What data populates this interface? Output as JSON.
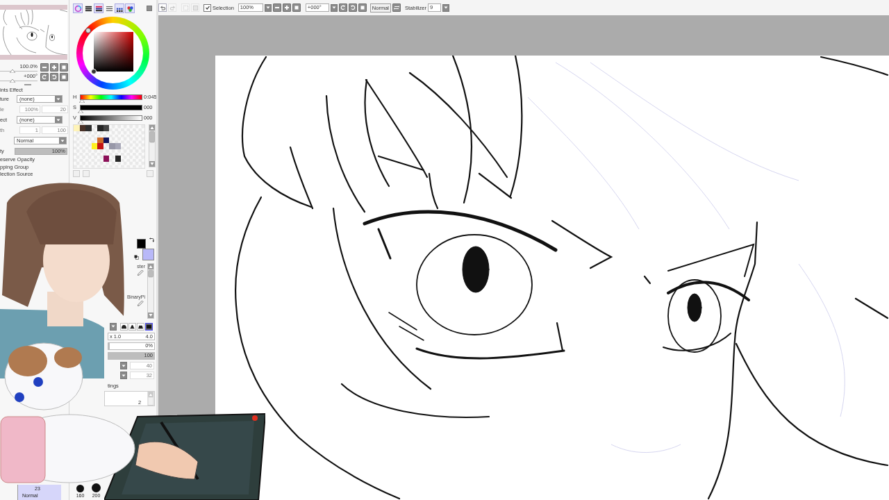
{
  "navigator": {
    "zoom": {
      "value": "100.0%",
      "level": 0.33
    },
    "angle": {
      "value": "+000°",
      "level": 0.33
    }
  },
  "layer_properties": {
    "section": "ints Effect",
    "rows": [
      {
        "kind": "dropdown",
        "label": "ture",
        "value": "(none)",
        "disabled": false
      },
      {
        "kind": "pair",
        "label": "le",
        "value": "100%",
        "second": "20",
        "disabled": true
      },
      {
        "kind": "dropdown",
        "label": "ect",
        "value": "(none)",
        "disabled": false
      },
      {
        "kind": "pair",
        "label": "th",
        "value": "1",
        "second": "100",
        "disabled": true
      },
      {
        "kind": "dropdown",
        "value": "Normal",
        "disabled": false
      },
      {
        "kind": "slider",
        "label": "ty",
        "reading": "100%",
        "level": 1,
        "disabled": false
      }
    ],
    "options": [
      "eserve Opacity",
      "pping Group",
      "lection Source"
    ]
  },
  "layer_entry": {
    "name": "23",
    "mode": "Normal",
    "selected": true
  },
  "color_panel": {
    "modes": [
      {
        "kind": "wheel",
        "on": true
      },
      {
        "kind": "rgb",
        "on": false
      },
      {
        "kind": "hsv",
        "on": true
      },
      {
        "kind": "lines",
        "on": false
      },
      {
        "kind": "swatches",
        "on": true
      },
      {
        "kind": "scratchpad",
        "on": true
      }
    ],
    "sliders": [
      {
        "label": "H",
        "kind": "hue",
        "level": 0.02,
        "reading": "0:045"
      },
      {
        "label": "S",
        "kind": "saturation",
        "level": 0,
        "reading": "000"
      },
      {
        "label": "V",
        "kind": "value",
        "level": 0,
        "reading": "000"
      }
    ],
    "swatch_rows": [
      [
        {
          "color": "#fff4b8"
        },
        {
          "color": "#4a3228"
        },
        {
          "color": "#2e2e2e"
        },
        null,
        {
          "color": "#242424"
        },
        {
          "color": "#454545"
        },
        null,
        null,
        null,
        null,
        null,
        null
      ],
      [
        null,
        null,
        null,
        null,
        null,
        null,
        null,
        null,
        null,
        null,
        null,
        null
      ],
      [
        null,
        null,
        null,
        null,
        {
          "color": "#d06a28"
        },
        {
          "color": "#14145a"
        },
        null,
        null,
        null,
        null,
        null,
        null
      ],
      [
        null,
        null,
        null,
        {
          "color": "#fff020"
        },
        {
          "color": "#c41414"
        },
        null,
        {
          "color": "#9898a8"
        },
        {
          "color": "#a8a8b8"
        },
        null,
        null,
        null,
        null
      ],
      [
        null,
        null,
        null,
        null,
        null,
        null,
        null,
        null,
        null,
        null,
        null,
        null
      ],
      [
        null,
        null,
        null,
        null,
        null,
        {
          "color": "#8c1058"
        },
        null,
        {
          "color": "#262626"
        },
        null,
        null,
        null,
        null
      ],
      [
        null,
        null,
        null,
        null,
        null,
        null,
        null,
        null,
        null,
        null,
        null,
        null
      ]
    ],
    "current_colors": [
      {
        "color": "#000000"
      },
      {
        "color": "#b8b8f8"
      }
    ]
  },
  "tools": [
    "ster",
    "BinaryPi"
  ],
  "brush": {
    "tips": [
      {
        "kind": "dome",
        "selected": false
      },
      {
        "kind": "triangle",
        "selected": false
      },
      {
        "kind": "trapezoid",
        "selected": false
      },
      {
        "kind": "square",
        "selected": true
      }
    ],
    "size": {
      "multiplier": "x 1.0",
      "value": "4.0"
    },
    "min_size": {
      "reading": "0%",
      "level": 0
    },
    "density": {
      "reading": "100",
      "level": 1
    },
    "texture_fields": [
      {
        "value": "40",
        "disabled": true
      },
      {
        "value": "32",
        "disabled": true
      }
    ],
    "section": "tings",
    "list_items": [
      "2"
    ],
    "size_presets": [
      {
        "label": "160"
      },
      {
        "label": "200"
      }
    ]
  },
  "toolbar": {
    "history": [
      {
        "kind": "undo",
        "disabled": false
      },
      {
        "kind": "redo",
        "disabled": true
      },
      {
        "kind": "deselect",
        "disabled": true
      },
      {
        "kind": "invert",
        "disabled": true
      }
    ],
    "selection": {
      "label": "Selection",
      "checked": true
    },
    "zoom": "100%",
    "angle": "+000°",
    "view_mode": "Normal",
    "stabilizer": {
      "label": "Stabilizer",
      "value": "9"
    }
  }
}
